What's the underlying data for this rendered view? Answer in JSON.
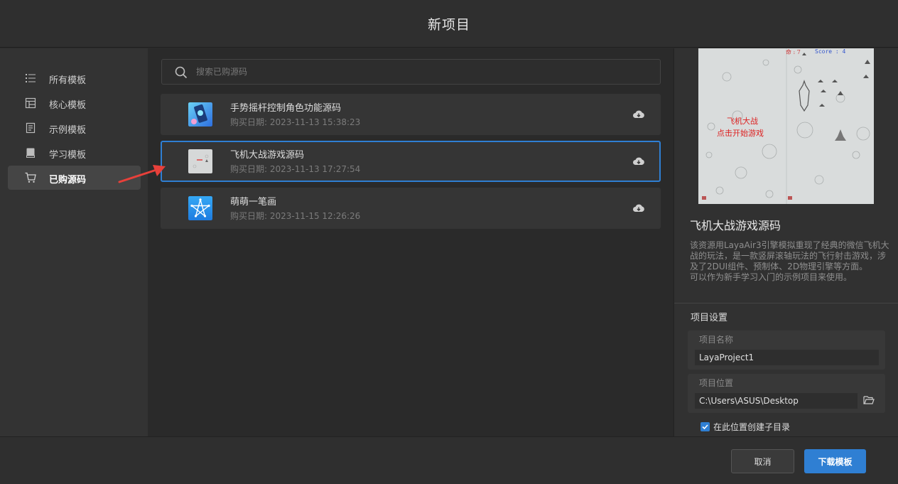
{
  "header": {
    "title": "新项目"
  },
  "sidebar": {
    "items": [
      {
        "label": "所有模板",
        "icon": "list-icon"
      },
      {
        "label": "核心模板",
        "icon": "layout-icon"
      },
      {
        "label": "示例模板",
        "icon": "document-icon"
      },
      {
        "label": "学习模板",
        "icon": "book-icon"
      },
      {
        "label": "已购源码",
        "icon": "cart-icon",
        "active": true
      }
    ]
  },
  "search": {
    "placeholder": "搜索已购源码"
  },
  "items": [
    {
      "name": "手势摇杆控制角色功能源码",
      "date": "购买日期: 2023-11-13 15:38:23"
    },
    {
      "name": "飞机大战游戏源码",
      "date": "购买日期: 2023-11-13 17:27:54",
      "selected": true
    },
    {
      "name": "萌萌一笔画",
      "date": "购买日期: 2023-11-15 12:26:26"
    }
  ],
  "detail": {
    "preview_hud_left": "命 : 7",
    "preview_hud_right": "Score : 4",
    "preview_text_line1": "飞机大战",
    "preview_text_line2": "点击开始游戏",
    "title": "飞机大战游戏源码",
    "description": "该资源用LayaAir3引擎模拟重现了经典的微信飞机大战的玩法，是一款竖屏滚轴玩法的飞行射击游戏，涉及了2DUI组件、预制体、2D物理引擎等方面。\n可以作为新手学习入门的示例项目来使用。"
  },
  "settings": {
    "title": "项目设置",
    "name_label": "项目名称",
    "name_value": "LayaProject1",
    "location_label": "项目位置",
    "location_value": "C:\\Users\\ASUS\\Desktop",
    "subdir_label": "在此位置创建子目录",
    "subdir_checked": true
  },
  "footer": {
    "cancel_label": "取消",
    "download_label": "下载模板"
  },
  "colors": {
    "accent": "#2f7fd3",
    "arrow": "#e8403a"
  }
}
